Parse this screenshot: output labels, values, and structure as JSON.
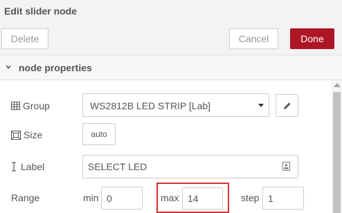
{
  "dialog": {
    "title": "Edit slider node"
  },
  "toolbar": {
    "delete_label": "Delete",
    "cancel_label": "Cancel",
    "done_label": "Done"
  },
  "section": {
    "title": "node properties"
  },
  "form": {
    "group": {
      "label": "Group",
      "selected": "WS2812B LED STRIP [Lab]",
      "icon": "table-icon"
    },
    "size": {
      "label": "Size",
      "value": "auto",
      "icon": "size-icon"
    },
    "label": {
      "label": "Label",
      "value": "SELECT LED",
      "icon": "text-cursor-icon"
    },
    "range": {
      "label": "Range",
      "min_label": "min",
      "min_value": "0",
      "max_label": "max",
      "max_value": "14",
      "step_label": "step",
      "step_value": "1"
    }
  },
  "colors": {
    "primary": "#ad1625",
    "highlight": "#d32f2f"
  }
}
